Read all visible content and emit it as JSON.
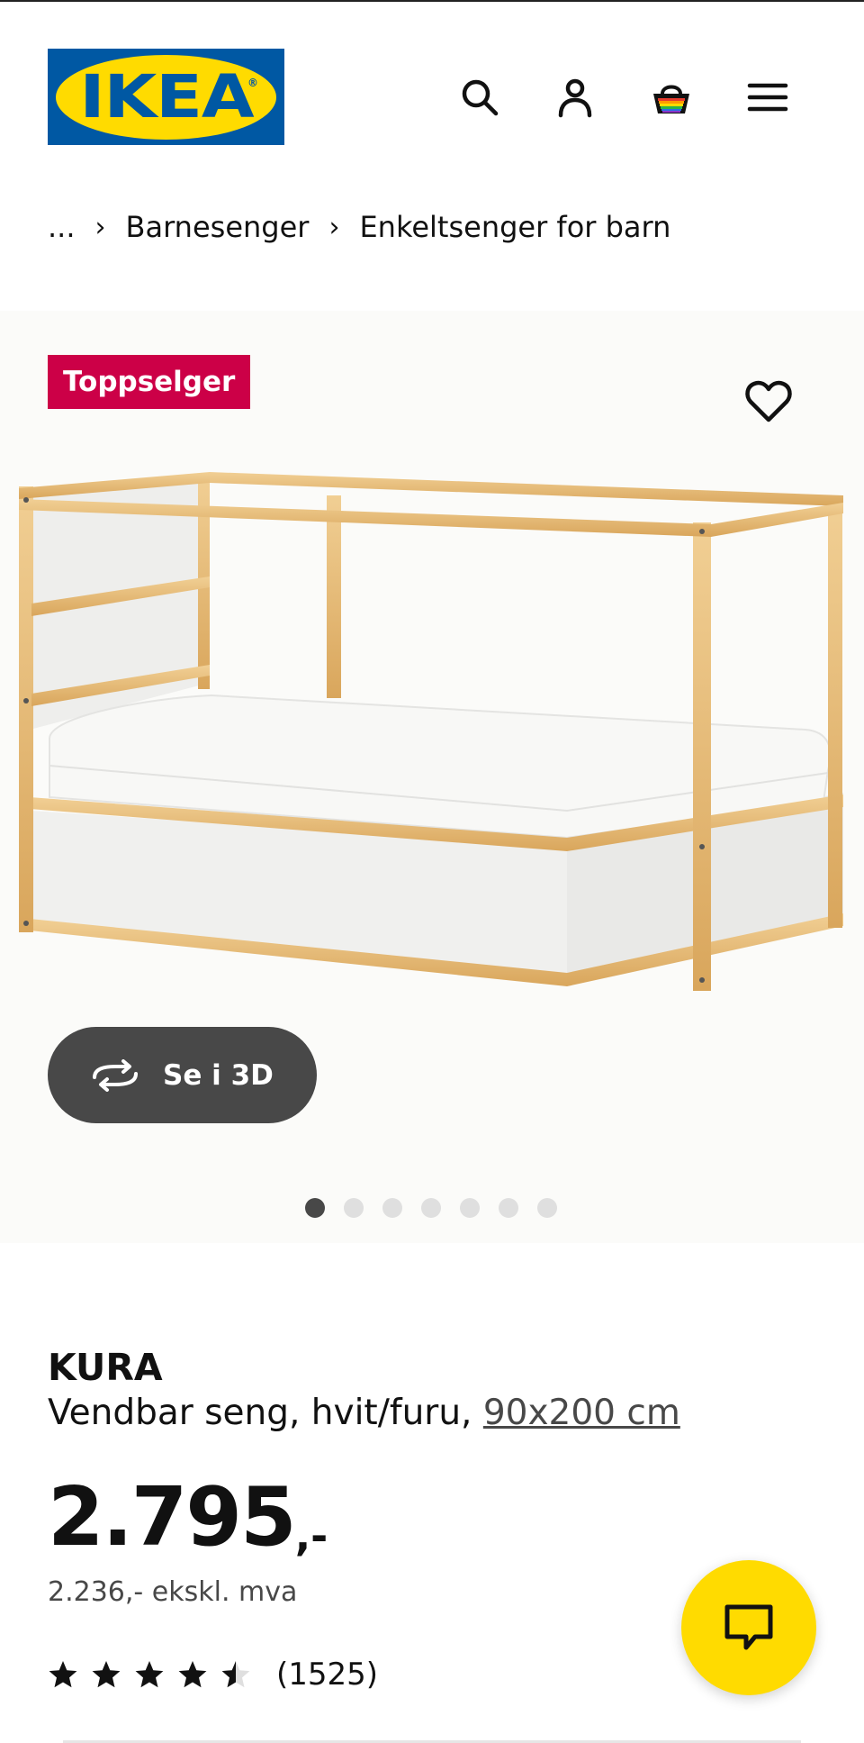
{
  "header": {
    "logo_text": "IKEA",
    "logo_mark": "®",
    "icons": [
      "search-icon",
      "account-icon",
      "shopping-bag-icon",
      "menu-icon"
    ]
  },
  "breadcrumb": {
    "ellipsis": "...",
    "items": [
      "Barnesenger",
      "Enkeltsenger for barn"
    ]
  },
  "media": {
    "badge": "Toppselger",
    "view_3d_label": "Se i 3D",
    "image_count": 7,
    "active_image": 1
  },
  "product": {
    "name": "KURA",
    "description": "Vendbar seng, hvit/furu, ",
    "size": "90x200 cm",
    "price": "2.795",
    "price_suffix": ",-",
    "price_ex_vat": "2.236,- ekskl. mva",
    "rating_value": 4.5,
    "rating_max": 5,
    "review_count": "(1525)"
  },
  "colors": {
    "brand_blue": "#0058a3",
    "brand_yellow": "#ffdb00",
    "badge_red": "#cc0047",
    "dark_button": "#484848"
  }
}
